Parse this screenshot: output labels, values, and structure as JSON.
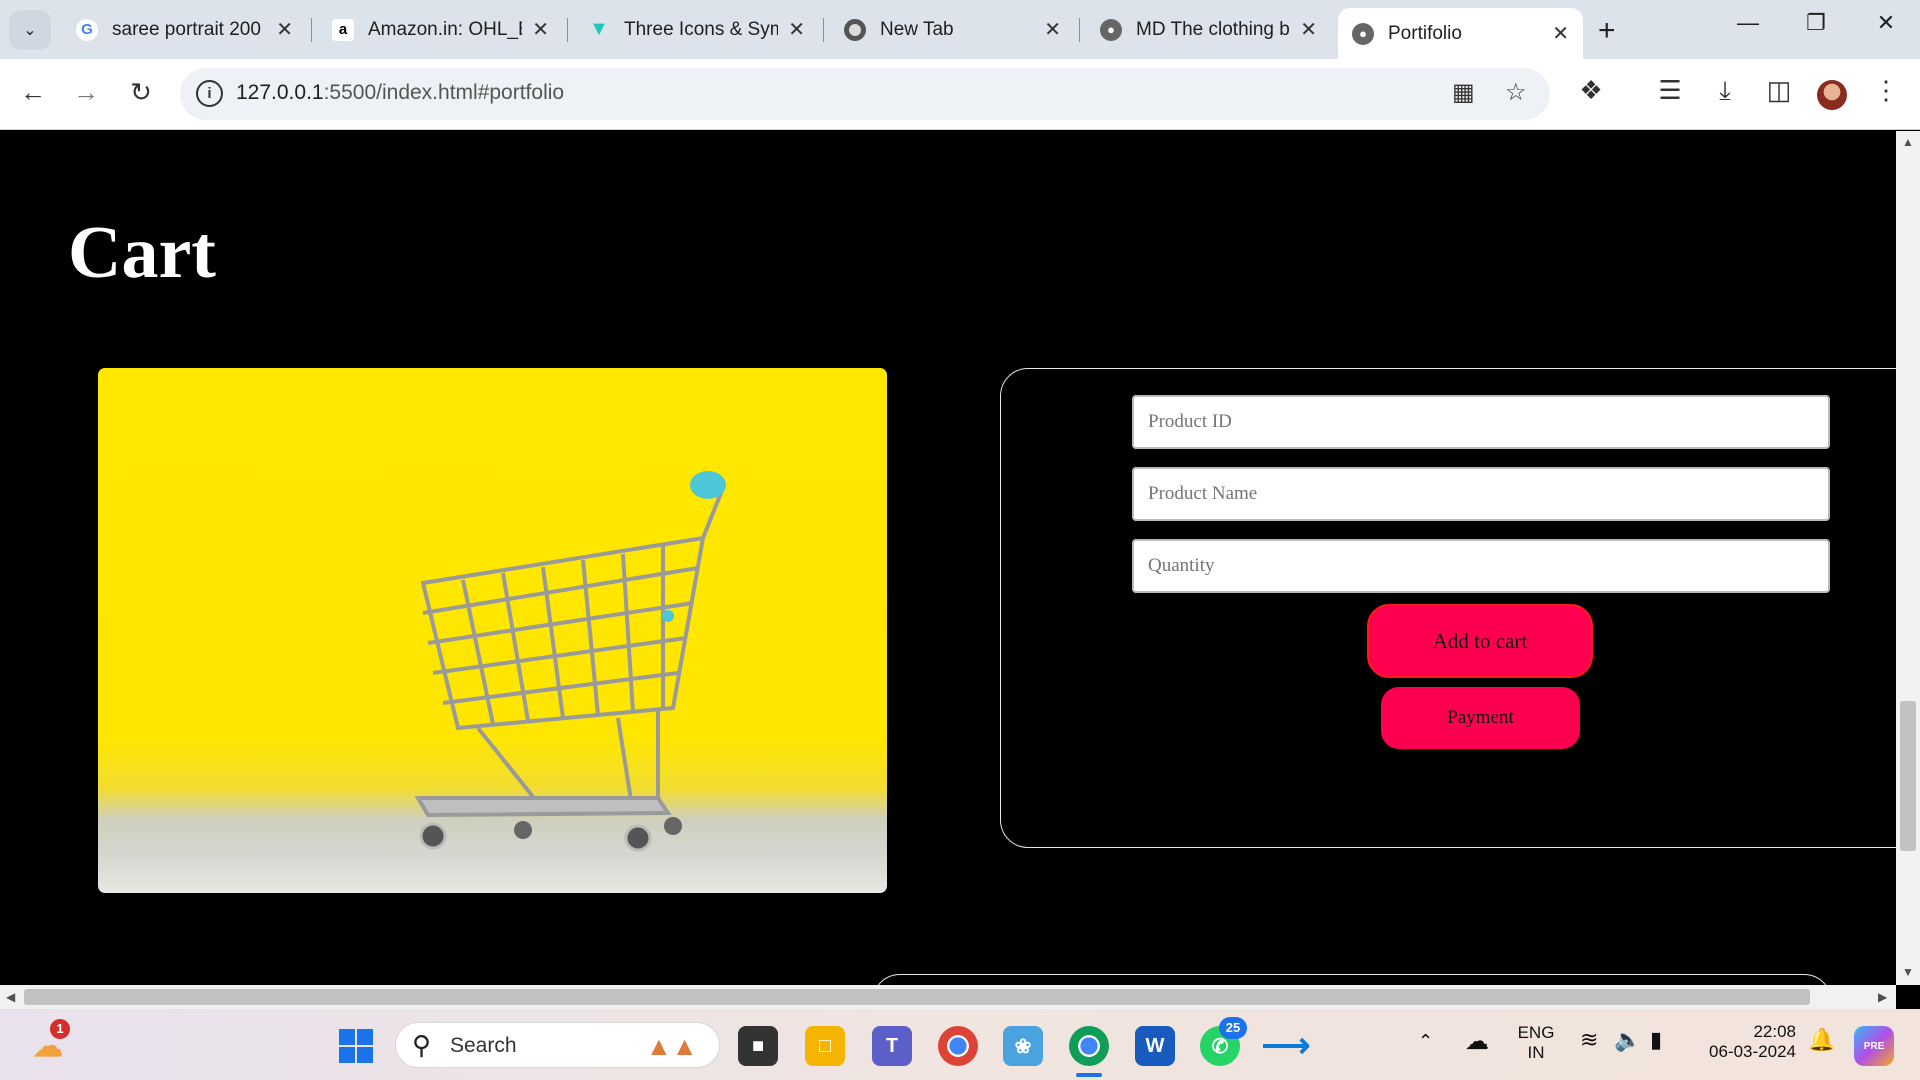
{
  "browser": {
    "tabs": [
      {
        "title": "saree portrait 200",
        "favicon": "google-icon",
        "active": false
      },
      {
        "title": "Amazon.in: OHL_B",
        "favicon": "amazon-icon",
        "active": false
      },
      {
        "title": "Three Icons & Sym",
        "favicon": "vuetify-icon",
        "active": false
      },
      {
        "title": "New Tab",
        "favicon": "chrome-icon",
        "active": false
      },
      {
        "title": "MD The clothing b",
        "favicon": "globe-icon",
        "active": false
      },
      {
        "title": "Portifolio",
        "favicon": "globe-icon",
        "active": true
      }
    ],
    "url_host": "127.0.0.1",
    "url_rest": ":5500/index.html#portfolio"
  },
  "page": {
    "cart_heading": "Cart",
    "form": {
      "product_id_placeholder": "Product ID",
      "product_name_placeholder": "Product Name",
      "quantity_placeholder": "Quantity",
      "add_to_cart_label": "Add to cart",
      "payment_label": "Payment"
    }
  },
  "taskbar": {
    "search_label": "Search",
    "weather_badge": "1",
    "whatsapp_badge": "25",
    "language_line1": "ENG",
    "language_line2": "IN",
    "time": "22:08",
    "date": "06-03-2024"
  },
  "colors": {
    "button_accent": "#ff0050",
    "page_background": "#000000"
  }
}
